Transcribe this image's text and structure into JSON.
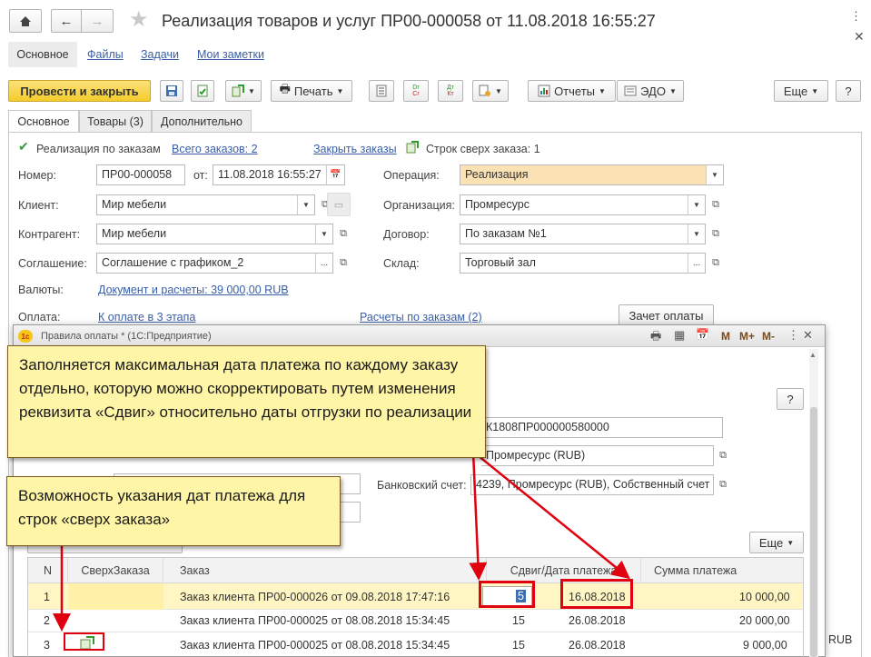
{
  "window": {
    "title": "Реализация товаров и услуг ПР00-000058 от 11.08.2018 16:55:27"
  },
  "nav_tabs": [
    {
      "label": "Основное"
    },
    {
      "label": "Файлы"
    },
    {
      "label": "Задачи"
    },
    {
      "label": "Мои заметки"
    }
  ],
  "toolbar": {
    "post_close": "Провести и закрыть",
    "print": "Печать",
    "reports": "Отчеты",
    "edo": "ЭДО",
    "more": "Еще",
    "help": "?",
    "dt_cr": "Дт\nКт"
  },
  "form_tabs": [
    {
      "label": "Основное"
    },
    {
      "label": "Товары (3)"
    },
    {
      "label": "Дополнительно"
    }
  ],
  "orders_bar": {
    "checkbox_label": "Реализация по заказам",
    "all_orders": "Всего заказов: 2",
    "close_orders": "Закрыть заказы",
    "extra_rows": "Строк сверх заказа: 1"
  },
  "fields": {
    "number_label": "Номер:",
    "number": "ПР00-000058",
    "from_label": "от:",
    "date": "11.08.2018 16:55:27",
    "operation_label": "Операция:",
    "operation": "Реализация",
    "client_label": "Клиент:",
    "client": "Мир мебели",
    "org_label": "Организация:",
    "org": "Промресурс",
    "contractor_label": "Контрагент:",
    "contractor": "Мир мебели",
    "contract_label": "Договор:",
    "contract": "По заказам №1",
    "agreement_label": "Соглашение:",
    "agreement": "Соглашение с графиком_2",
    "warehouse_label": "Склад:",
    "warehouse": "Торговый зал",
    "currency_label": "Валюты:",
    "currency_link": "Документ и расчеты: 39 000,00 RUB",
    "payment_label": "Оплата:",
    "payment_link": "К оплате в 3 этапа",
    "settlements_link": "Расчеты по заказам (2)",
    "offset_button": "Зачет оплаты"
  },
  "modal": {
    "title": "Правила оплаты * (1С:Предприятие)",
    "toolbar_m": "M",
    "toolbar_mplus": "M+",
    "toolbar_mminus": "M-",
    "help": "?",
    "account_number": "К1808ПР000000580000",
    "payer": "Промресурс (RUB)",
    "bank_label": "Банковский счет:",
    "bank_account": "4239, Промресурс (RUB), Собственный счет",
    "more": "Еще",
    "columns": [
      "N",
      "СверхЗаказа",
      "Заказ",
      "Сдвиг/Дата платежа",
      "Сумма платежа"
    ],
    "rows": [
      {
        "n": "1",
        "order": "Заказ клиента ПР00-000026 от 09.08.2018 17:47:16",
        "shift": "5",
        "date": "16.08.2018",
        "sum": "10 000,00"
      },
      {
        "n": "2",
        "order": "Заказ клиента ПР00-000025 от 08.08.2018 15:34:45",
        "shift": "15",
        "date": "26.08.2018",
        "sum": "20 000,00"
      },
      {
        "n": "3",
        "order": "Заказ клиента ПР00-000025 от 08.08.2018 15:34:45",
        "shift": "15",
        "date": "26.08.2018",
        "sum": "9 000,00"
      }
    ],
    "rub": "RUB"
  },
  "callouts": {
    "top": "Заполняется максимальная дата платежа по каждому заказу отдельно, которую можно скорректировать путем изменения реквизита «Сдвиг» относительно даты отгрузки по реализации",
    "bottom": "Возможность указания дат платежа для строк «сверх заказа»"
  },
  "colors": {
    "accent_yellow": "#f7d64a",
    "selected_row": "#fff6c4",
    "operation_bg": "#fbe2b4",
    "annotation_red": "#e0000f"
  }
}
